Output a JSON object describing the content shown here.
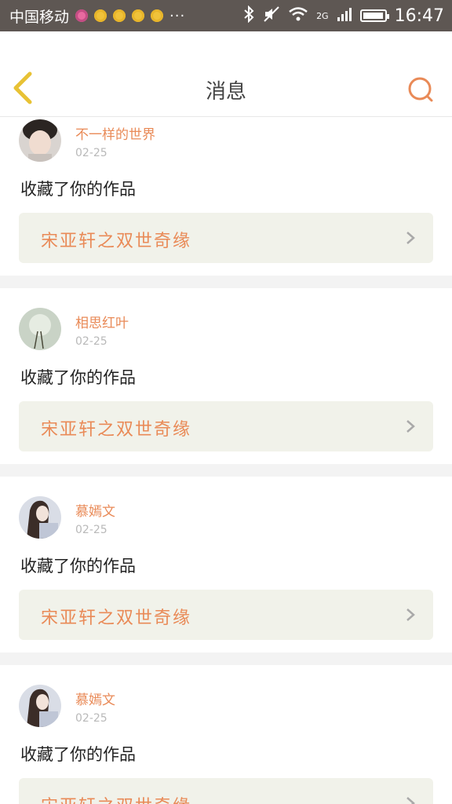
{
  "status_bar": {
    "carrier": "中国移动",
    "network": "2G",
    "time": "16:47",
    "more": "···"
  },
  "header": {
    "title": "消息"
  },
  "messages": [
    {
      "name": "不一样的世界",
      "date": "02-25",
      "text": "收藏了你的作品",
      "work": "宋亚轩之双世奇缘"
    },
    {
      "name": "相思红叶",
      "date": "02-25",
      "text": "收藏了你的作品",
      "work": "宋亚轩之双世奇缘"
    },
    {
      "name": "慕嫣文",
      "date": "02-25",
      "text": "收藏了你的作品",
      "work": "宋亚轩之双世奇缘"
    },
    {
      "name": "慕嫣文",
      "date": "02-25",
      "text": "收藏了你的作品",
      "work": "宋亚轩之双世奇缘"
    }
  ],
  "colors": {
    "accent": "#e98a57",
    "status_bar": "#5e5753",
    "card_box": "#f1f2ea",
    "back_arrow": "#e8c235"
  },
  "icons": {
    "back": "back-arrow-icon",
    "search": "search-icon",
    "chevron": "chevron-right-icon"
  }
}
